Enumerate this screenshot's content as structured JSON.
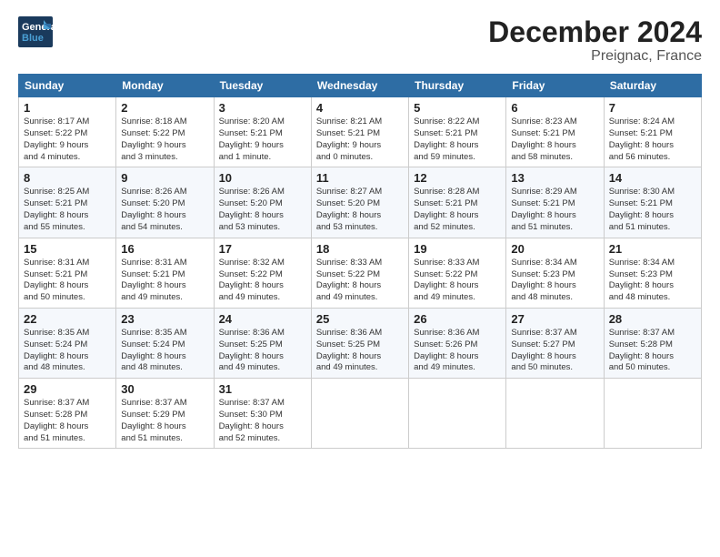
{
  "app": {
    "logo_line1": "General",
    "logo_line2": "Blue",
    "title": "December 2024",
    "subtitle": "Preignac, France"
  },
  "calendar": {
    "headers": [
      "Sunday",
      "Monday",
      "Tuesday",
      "Wednesday",
      "Thursday",
      "Friday",
      "Saturday"
    ],
    "weeks": [
      [
        {
          "day": "1",
          "info": "Sunrise: 8:17 AM\nSunset: 5:22 PM\nDaylight: 9 hours\nand 4 minutes."
        },
        {
          "day": "2",
          "info": "Sunrise: 8:18 AM\nSunset: 5:22 PM\nDaylight: 9 hours\nand 3 minutes."
        },
        {
          "day": "3",
          "info": "Sunrise: 8:20 AM\nSunset: 5:21 PM\nDaylight: 9 hours\nand 1 minute."
        },
        {
          "day": "4",
          "info": "Sunrise: 8:21 AM\nSunset: 5:21 PM\nDaylight: 9 hours\nand 0 minutes."
        },
        {
          "day": "5",
          "info": "Sunrise: 8:22 AM\nSunset: 5:21 PM\nDaylight: 8 hours\nand 59 minutes."
        },
        {
          "day": "6",
          "info": "Sunrise: 8:23 AM\nSunset: 5:21 PM\nDaylight: 8 hours\nand 58 minutes."
        },
        {
          "day": "7",
          "info": "Sunrise: 8:24 AM\nSunset: 5:21 PM\nDaylight: 8 hours\nand 56 minutes."
        }
      ],
      [
        {
          "day": "8",
          "info": "Sunrise: 8:25 AM\nSunset: 5:21 PM\nDaylight: 8 hours\nand 55 minutes."
        },
        {
          "day": "9",
          "info": "Sunrise: 8:26 AM\nSunset: 5:20 PM\nDaylight: 8 hours\nand 54 minutes."
        },
        {
          "day": "10",
          "info": "Sunrise: 8:26 AM\nSunset: 5:20 PM\nDaylight: 8 hours\nand 53 minutes."
        },
        {
          "day": "11",
          "info": "Sunrise: 8:27 AM\nSunset: 5:20 PM\nDaylight: 8 hours\nand 53 minutes."
        },
        {
          "day": "12",
          "info": "Sunrise: 8:28 AM\nSunset: 5:21 PM\nDaylight: 8 hours\nand 52 minutes."
        },
        {
          "day": "13",
          "info": "Sunrise: 8:29 AM\nSunset: 5:21 PM\nDaylight: 8 hours\nand 51 minutes."
        },
        {
          "day": "14",
          "info": "Sunrise: 8:30 AM\nSunset: 5:21 PM\nDaylight: 8 hours\nand 51 minutes."
        }
      ],
      [
        {
          "day": "15",
          "info": "Sunrise: 8:31 AM\nSunset: 5:21 PM\nDaylight: 8 hours\nand 50 minutes."
        },
        {
          "day": "16",
          "info": "Sunrise: 8:31 AM\nSunset: 5:21 PM\nDaylight: 8 hours\nand 49 minutes."
        },
        {
          "day": "17",
          "info": "Sunrise: 8:32 AM\nSunset: 5:22 PM\nDaylight: 8 hours\nand 49 minutes."
        },
        {
          "day": "18",
          "info": "Sunrise: 8:33 AM\nSunset: 5:22 PM\nDaylight: 8 hours\nand 49 minutes."
        },
        {
          "day": "19",
          "info": "Sunrise: 8:33 AM\nSunset: 5:22 PM\nDaylight: 8 hours\nand 49 minutes."
        },
        {
          "day": "20",
          "info": "Sunrise: 8:34 AM\nSunset: 5:23 PM\nDaylight: 8 hours\nand 48 minutes."
        },
        {
          "day": "21",
          "info": "Sunrise: 8:34 AM\nSunset: 5:23 PM\nDaylight: 8 hours\nand 48 minutes."
        }
      ],
      [
        {
          "day": "22",
          "info": "Sunrise: 8:35 AM\nSunset: 5:24 PM\nDaylight: 8 hours\nand 48 minutes."
        },
        {
          "day": "23",
          "info": "Sunrise: 8:35 AM\nSunset: 5:24 PM\nDaylight: 8 hours\nand 48 minutes."
        },
        {
          "day": "24",
          "info": "Sunrise: 8:36 AM\nSunset: 5:25 PM\nDaylight: 8 hours\nand 49 minutes."
        },
        {
          "day": "25",
          "info": "Sunrise: 8:36 AM\nSunset: 5:25 PM\nDaylight: 8 hours\nand 49 minutes."
        },
        {
          "day": "26",
          "info": "Sunrise: 8:36 AM\nSunset: 5:26 PM\nDaylight: 8 hours\nand 49 minutes."
        },
        {
          "day": "27",
          "info": "Sunrise: 8:37 AM\nSunset: 5:27 PM\nDaylight: 8 hours\nand 50 minutes."
        },
        {
          "day": "28",
          "info": "Sunrise: 8:37 AM\nSunset: 5:28 PM\nDaylight: 8 hours\nand 50 minutes."
        }
      ],
      [
        {
          "day": "29",
          "info": "Sunrise: 8:37 AM\nSunset: 5:28 PM\nDaylight: 8 hours\nand 51 minutes."
        },
        {
          "day": "30",
          "info": "Sunrise: 8:37 AM\nSunset: 5:29 PM\nDaylight: 8 hours\nand 51 minutes."
        },
        {
          "day": "31",
          "info": "Sunrise: 8:37 AM\nSunset: 5:30 PM\nDaylight: 8 hours\nand 52 minutes."
        },
        null,
        null,
        null,
        null
      ]
    ]
  }
}
